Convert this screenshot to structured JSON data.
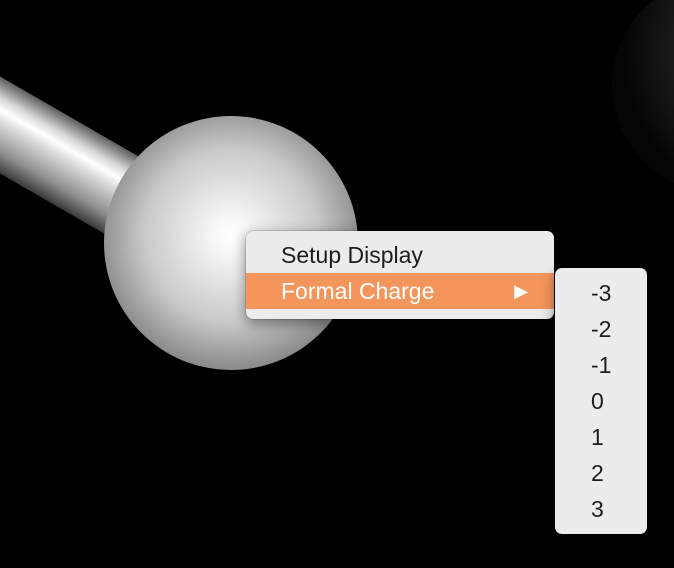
{
  "colors": {
    "background": "#000000",
    "menu_background": "#ececec",
    "highlight": "#f4965c",
    "menu_text": "#1d1d1d",
    "highlight_text": "#ffffff"
  },
  "context_menu": {
    "items": [
      {
        "label": "Setup Display",
        "highlighted": false
      },
      {
        "label": "Formal Charge",
        "highlighted": true,
        "has_submenu": true,
        "arrow_icon": "triangle-right-icon"
      }
    ]
  },
  "formal_charge_submenu": {
    "options": [
      "-3",
      "-2",
      "-1",
      "0",
      "1",
      "2",
      "3"
    ]
  }
}
